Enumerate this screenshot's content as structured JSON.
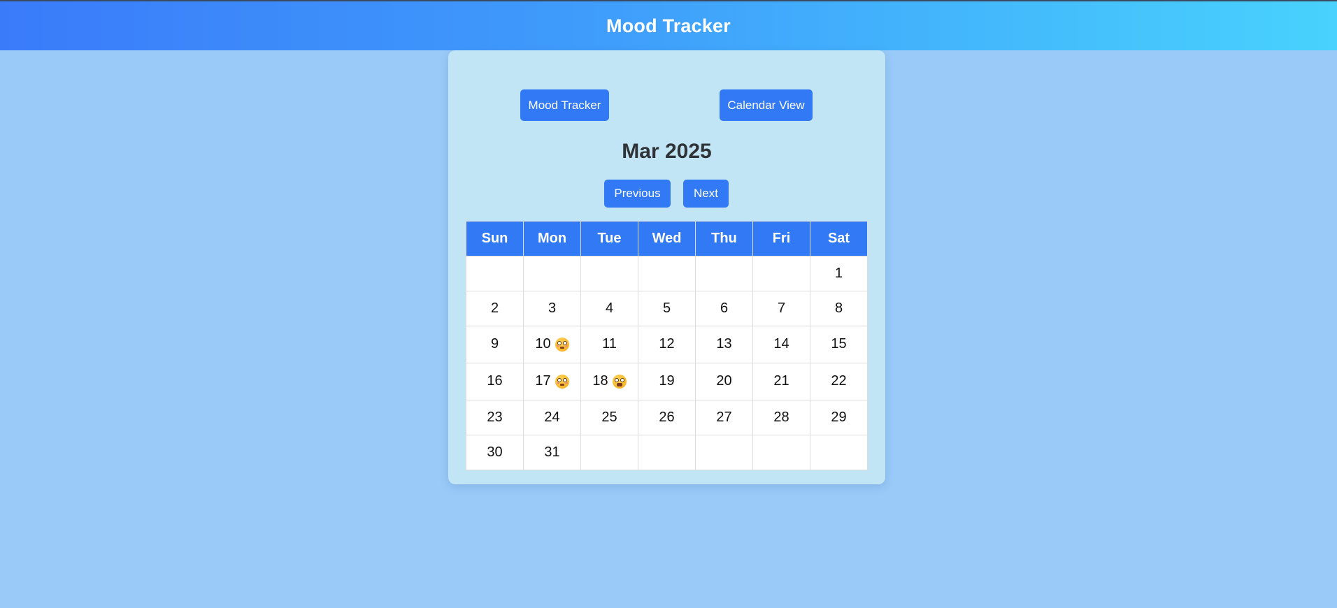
{
  "header": {
    "title": "Mood Tracker"
  },
  "nav": {
    "mood_tracker_label": "Mood Tracker",
    "calendar_view_label": "Calendar View"
  },
  "calendar": {
    "month_label": "Mar 2025",
    "previous_label": "Previous",
    "next_label": "Next",
    "weekdays": [
      "Sun",
      "Mon",
      "Tue",
      "Wed",
      "Thu",
      "Fri",
      "Sat"
    ],
    "weeks": [
      [
        "",
        "",
        "",
        "",
        "",
        "",
        "1"
      ],
      [
        "2",
        "3",
        "4",
        "5",
        "6",
        "7",
        "8"
      ],
      [
        "9",
        "10",
        "11",
        "12",
        "13",
        "14",
        "15"
      ],
      [
        "16",
        "17",
        "18",
        "19",
        "20",
        "21",
        "22"
      ],
      [
        "23",
        "24",
        "25",
        "26",
        "27",
        "28",
        "29"
      ],
      [
        "30",
        "31",
        "",
        "",
        "",
        "",
        ""
      ]
    ],
    "moods": [
      {
        "day": "10",
        "icon": "flushed-face-emoji-icon"
      },
      {
        "day": "17",
        "icon": "flushed-face-emoji-icon"
      },
      {
        "day": "18",
        "icon": "grimacing-face-emoji-icon"
      }
    ]
  },
  "colors": {
    "page_background": "#99caf8",
    "header_gradient_start": "#3a7bfa",
    "header_gradient_end": "#48d2fd",
    "card_background": "#c1e5f4",
    "button": "#3279f5",
    "title_text": "#2f3236"
  }
}
